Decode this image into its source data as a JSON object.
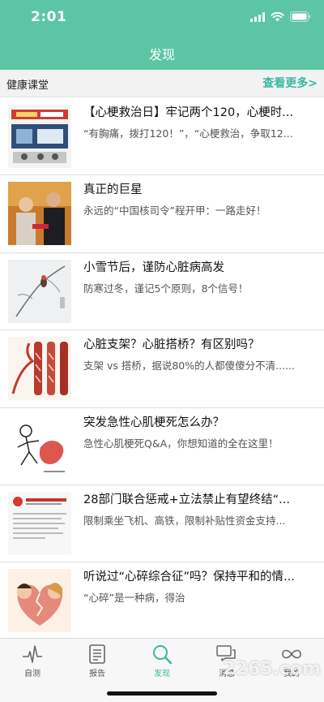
{
  "status_bar": {
    "time": "2:01"
  },
  "nav": {
    "title": "发现"
  },
  "section": {
    "title": "健康课堂",
    "more_label": "查看更多>"
  },
  "articles": [
    {
      "title": "【心梗救治日】牢记两个120，心梗时...",
      "summary": "“有胸痛，拨打120！”，“心梗救治，争取12..."
    },
    {
      "title": "真正的巨星",
      "summary": "永远的“中国核司令”程开甲：一路走好！"
    },
    {
      "title": "小雪节后，谨防心脏病高发",
      "summary": "防寒过冬，谨记5个原则，8个信号！"
    },
    {
      "title": "心脏支架？心脏搭桥？有区别吗？",
      "summary": "支架 vs 搭桥，据说80%的人都傻傻分不清......"
    },
    {
      "title": "突发急性心肌梗死怎么办？",
      "summary": "急性心肌梗死Q&A，你想知道的全在这里！"
    },
    {
      "title": "28部门联合惩戒+立法禁止有望终结“...",
      "summary": "限制乘坐飞机、高铁，限制补贴性资金支持..."
    },
    {
      "title": "听说过“心碎综合征”吗？保持平和的情...",
      "summary": "“心碎”是一种病，得治"
    }
  ],
  "tabs": [
    {
      "label": "自测",
      "icon": "pulse-icon"
    },
    {
      "label": "报告",
      "icon": "report-icon"
    },
    {
      "label": "发现",
      "icon": "search-icon",
      "active": true
    },
    {
      "label": "消息",
      "icon": "chat-icon"
    },
    {
      "label": "我的",
      "icon": "infinity-icon"
    }
  ],
  "watermark": "2265.com",
  "colors": {
    "accent": "#5cc6a4",
    "link": "#38b8a0"
  }
}
